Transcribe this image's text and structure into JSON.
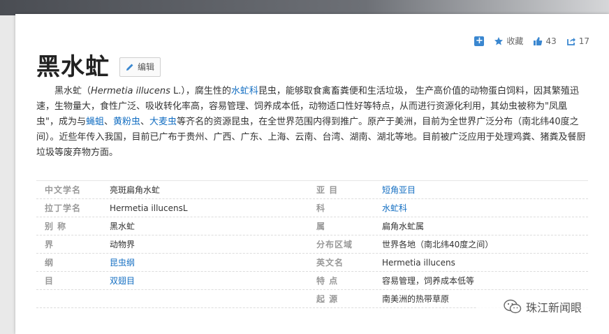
{
  "toolbar": {
    "favorite_label": "收藏",
    "like_count": "43",
    "share_count": "17"
  },
  "title": "黑水虻",
  "edit_label": "编辑",
  "summary": {
    "p1": "黑水虻（",
    "latin": "Hermetia illucens",
    "p2": " L.），腐生性的",
    "link_family": "水虻科",
    "p3": "昆虫，能够取食禽畜粪便和生活垃圾， 生产高价值的动物蛋白饲料，因其繁殖迅速，生物量大，食性广泛、吸收转化率高，容易管理、饲养成本低，动物适口性好等特点，从而进行资源化利用，其幼虫被称为\"凤凰虫\"，成为与",
    "link_maggot": "蝇蛆",
    "sep1": "、",
    "link_mealworm": "黄粉虫",
    "sep2": "、",
    "link_superworm": "大麦虫",
    "p4": "等齐名的资源昆虫，在全世界范围内得到推广。原产于美洲，目前为全世界广泛分布（南北纬40度之间）。近些年传入我国，目前已广布于贵州、广西、广东、上海、云南、台湾、湖南、湖北等地。目前被广泛应用于处理鸡粪、猪粪及餐厨垃圾等废弃物方面。"
  },
  "basic_info": [
    {
      "l_label": "中文学名",
      "l_value": "亮斑扁角水虻",
      "r_label": "亚 目",
      "r_value": "短角亚目"
    },
    {
      "l_label": "拉丁学名",
      "l_value": "Hermetia illucensL",
      "r_label": "科",
      "r_value": "水虻科"
    },
    {
      "l_label": "别 称",
      "l_value": "黑水虻",
      "r_label": "属",
      "r_value": "扁角水虻属"
    },
    {
      "l_label": "界",
      "l_value": "动物界",
      "r_label": "分布区域",
      "r_value": "世界各地（南北纬40度之间）"
    },
    {
      "l_label": "纲",
      "l_value": "昆虫纲",
      "r_label": "英文名",
      "r_value": "Hermetia illucens"
    },
    {
      "l_label": "目",
      "l_value": "双翅目",
      "r_label": "特 点",
      "r_value": "容易管理，饲养成本低等"
    },
    {
      "l_label": "",
      "l_value": "",
      "r_label": "起 源",
      "r_value": "南美洲的热带草原"
    }
  ],
  "watermark": "珠江新闻眼",
  "colors": {
    "link": "#136ec2",
    "label_gray": "#999999",
    "icon_blue": "#3a87d0"
  }
}
